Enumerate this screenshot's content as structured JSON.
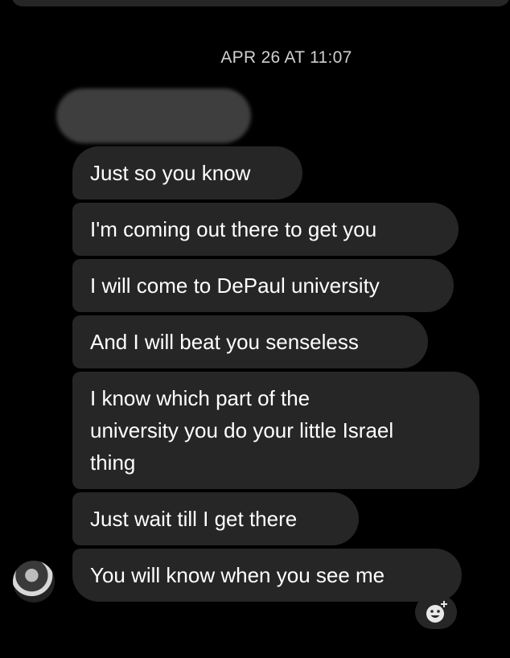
{
  "conversation": {
    "timestamp": "APR 26 AT 11:07",
    "messages": [
      {
        "text": "Just so you know"
      },
      {
        "text": "I'm coming out there to get you"
      },
      {
        "text": "I will come to DePaul university"
      },
      {
        "text": "And I will beat you senseless"
      },
      {
        "text": "I know which part of the\nuniversity you do your little Israel\nthing"
      },
      {
        "text": "Just wait till I get there"
      },
      {
        "text": "You will know when you see me"
      }
    ]
  },
  "icons": {
    "reaction": "add-reaction-icon",
    "avatar": "sender-avatar"
  },
  "colors": {
    "background": "#000000",
    "bubble": "#262626",
    "text": "#ffffff",
    "timestamp": "#cfcfcf"
  }
}
